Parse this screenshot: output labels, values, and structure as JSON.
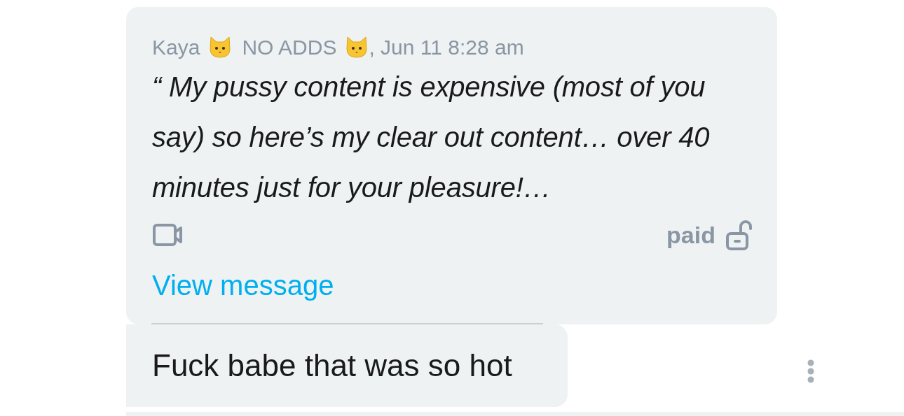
{
  "quoted_message": {
    "author": "Kaya",
    "author_tag": "NO ADDS",
    "timestamp": ", Jun 11 8:28 am",
    "text": "“ My pussy content is expensive (most of you say) so here’s my clear out content… over 40 minutes just for your pleasure!…",
    "price_status": "paid",
    "locked": false,
    "link": "View message"
  },
  "reply": {
    "text": "Fuck babe that was so hot"
  }
}
